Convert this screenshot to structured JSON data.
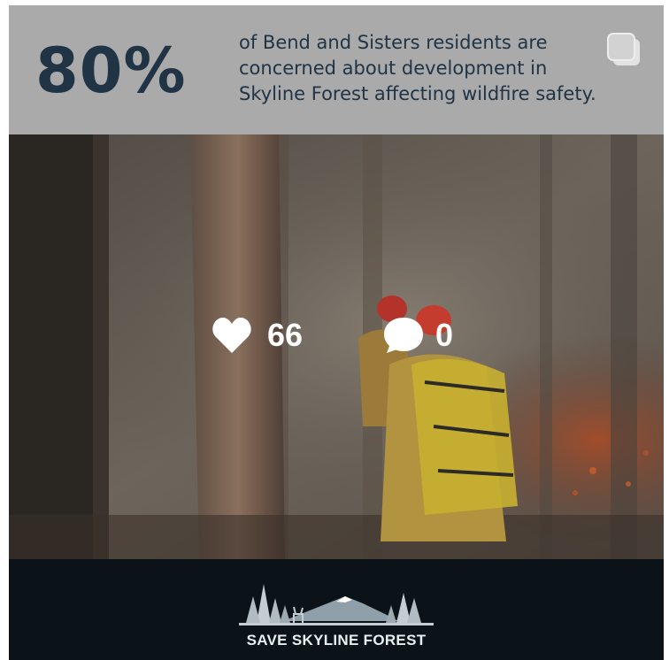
{
  "header": {
    "stat": "80%",
    "headline_lines": [
      "of Bend and Sisters residents are",
      "concerned about development in",
      "Skyline Forest affecting wildfire safety."
    ]
  },
  "overlay": {
    "likes": "66",
    "comments": "0"
  },
  "footer": {
    "logo_text": "SAVE SKYLINE FOREST"
  },
  "icons": {
    "multi": "multiple-images-icon",
    "like": "heart-icon",
    "comment": "comment-bubble-icon"
  },
  "colors": {
    "header_bg": "#a9aaa9",
    "text_navy": "#203446",
    "footer_bg": "#0c1318"
  }
}
